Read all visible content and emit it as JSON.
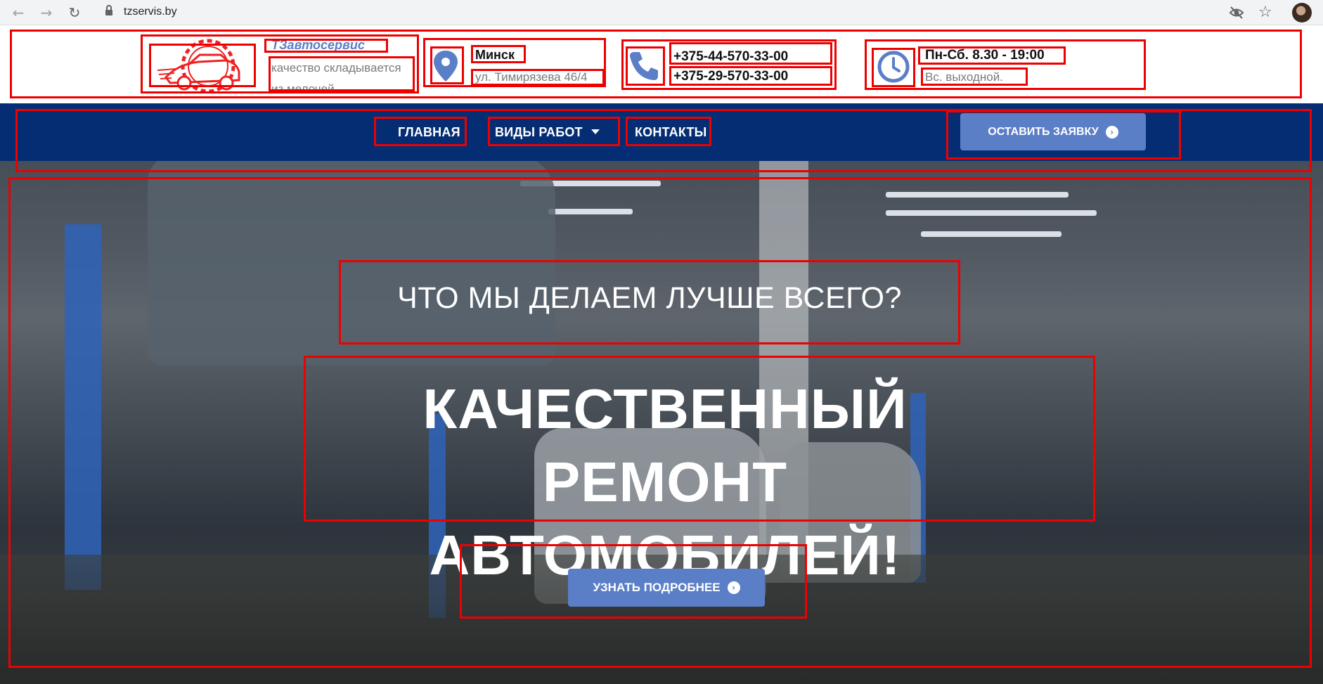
{
  "browser": {
    "url": "tzservis.by",
    "back_glyph": "←",
    "forward_glyph": "→",
    "reload_glyph": "↻",
    "star_glyph": "☆"
  },
  "header": {
    "brand_name": "ТЗавтосервис",
    "tagline": "качество складывается из мелочей",
    "city": "Минск",
    "address": "ул. Тимирязева 46/4",
    "phone_1": "+375-44-570-33-00",
    "phone_2": "+375-29-570-33-00",
    "hours": "Пн-Сб. 8.30 - 19:00",
    "day_off": "Вс. выходной."
  },
  "nav": {
    "items": [
      {
        "label": "ГЛАВНАЯ"
      },
      {
        "label": "ВИДЫ РАБОТ"
      },
      {
        "label": "КОНТАКТЫ"
      }
    ],
    "cta_label": "ОСТАВИТЬ ЗАЯВКУ",
    "arrow_glyph": "›"
  },
  "hero": {
    "subtitle": "ЧТО МЫ ДЕЛАЕМ ЛУЧШЕ ВСЕГО?",
    "title_line_1": "КАЧЕСТВЕННЫЙ РЕМОНТ",
    "title_line_2": "АВТОМОБИЛЕЙ!",
    "button_label": "УЗНАТЬ ПОДРОБНЕЕ"
  },
  "colors": {
    "accent": "#5b7fc7",
    "nav_background": "#052d74",
    "annotation_red": "#ee0000"
  }
}
